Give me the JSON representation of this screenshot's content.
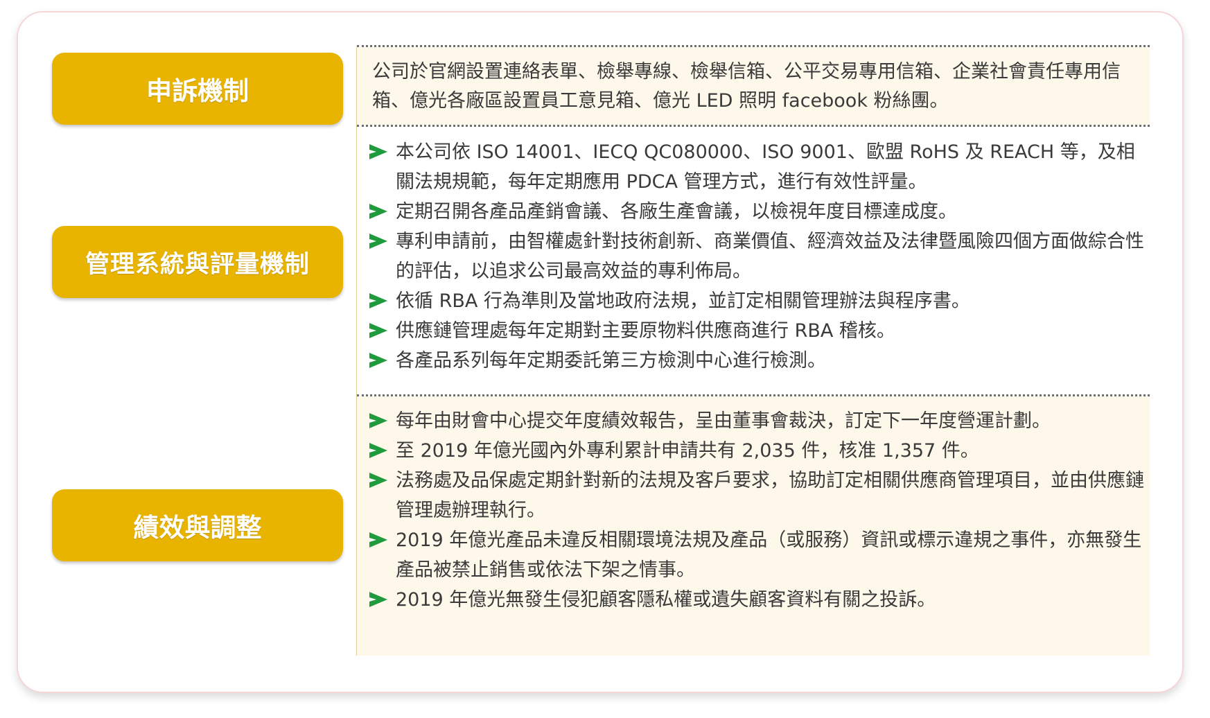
{
  "sections": [
    {
      "label": "申訴機制",
      "text": "公司於官網設置連絡表單、檢舉專線、檢舉信箱、公平交易專用信箱、企業社會責任專用信箱、億光各廠區設置員工意見箱、億光 LED 照明 facebook 粉絲團。"
    },
    {
      "label": "管理系統與評量機制",
      "items": [
        "本公司依 ISO 14001、IECQ QC080000、ISO 9001、歐盟 RoHS 及 REACH 等，及相關法規規範，每年定期應用 PDCA 管理方式，進行有效性評量。",
        "定期召開各產品產銷會議、各廠生產會議，以檢視年度目標達成度。",
        "專利申請前，由智權處針對技術創新、商業價值、經濟效益及法律暨風險四個方面做綜合性的評估，以追求公司最高效益的專利佈局。",
        "依循 RBA 行為準則及當地政府法規，並訂定相關管理辦法與程序書。",
        "供應鏈管理處每年定期對主要原物料供應商進行 RBA 稽核。",
        "各產品系列每年定期委託第三方檢測中心進行檢測。"
      ]
    },
    {
      "label": "績效與調整",
      "items": [
        "每年由財會中心提交年度績效報告，呈由董事會裁決，訂定下一年度營運計劃。",
        "至 2019 年億光國內外專利累計申請共有 2,035 件，核准 1,357 件。",
        "法務處及品保處定期針對新的法規及客戶要求，協助訂定相關供應商管理項目，並由供應鏈管理處辦理執行。",
        "2019 年億光產品未違反相關環境法規及產品（或服務）資訊或標示違規之事件，亦無發生產品被禁止銷售或依法下架之情事。",
        "2019 年億光無發生侵犯顧客隱私權或遺失顧客資料有關之投訴。"
      ]
    }
  ],
  "colors": {
    "label_background": "#e8b400",
    "label_text": "#ffffff",
    "bullet_arrow": "#1f9a3c",
    "section_background": "#fdf8ea",
    "body_text": "#3a3a3a"
  },
  "icons": {
    "bullet": "green-arrow-bullet-icon"
  }
}
